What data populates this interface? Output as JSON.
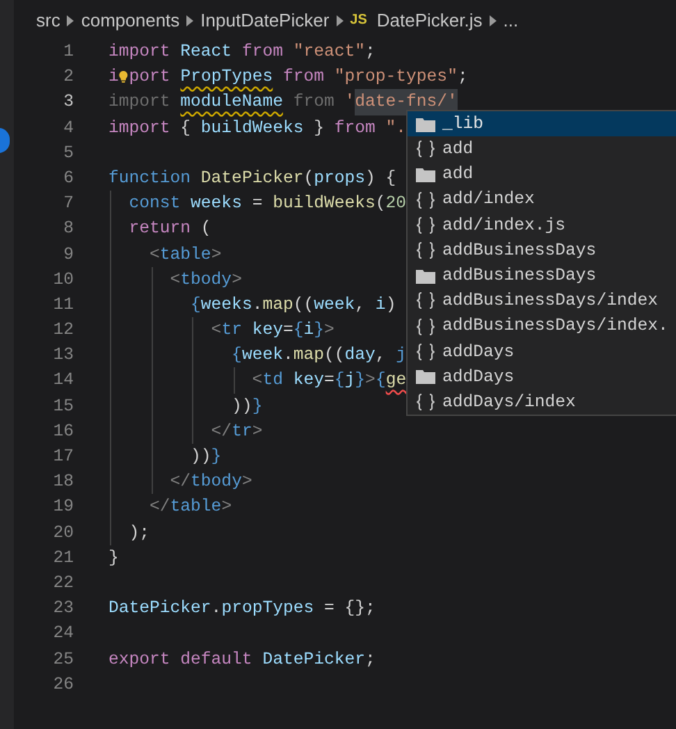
{
  "breadcrumb": [
    {
      "label": "src"
    },
    {
      "label": "components"
    },
    {
      "label": "InputDatePicker"
    },
    {
      "label": "DatePicker.js",
      "badge": "JS"
    },
    {
      "label": "..."
    }
  ],
  "lines": [
    {
      "number": "1",
      "current": false,
      "tokens": [
        {
          "text": "import ",
          "kind": "keyword"
        },
        {
          "text": "React ",
          "kind": "variable"
        },
        {
          "text": "from ",
          "kind": "keyword"
        },
        {
          "text": "\"react\"",
          "kind": "string"
        },
        {
          "text": ";",
          "kind": "punct"
        }
      ]
    },
    {
      "number": "2",
      "current": false,
      "tokens": [
        {
          "text": "i",
          "kind": "keyword"
        },
        {
          "kind": "bulb"
        },
        {
          "text": "port ",
          "kind": "keyword"
        },
        {
          "text": "PropTypes",
          "kind": "variable",
          "warning": true
        },
        {
          "text": " from ",
          "kind": "keyword"
        },
        {
          "text": "\"prop-types\"",
          "kind": "string"
        },
        {
          "text": ";",
          "kind": "punct"
        }
      ]
    },
    {
      "number": "3",
      "current": true,
      "tokens": [
        {
          "text": "import ",
          "kind": "faded"
        },
        {
          "text": "moduleName",
          "kind": "variable",
          "warning": true
        },
        {
          "text": " from ",
          "kind": "faded"
        },
        {
          "text": "'",
          "kind": "string"
        },
        {
          "text": "date-fns/'",
          "kind": "string",
          "highlighted": true
        }
      ]
    },
    {
      "number": "4",
      "current": false,
      "tokens": [
        {
          "text": "import ",
          "kind": "keyword"
        },
        {
          "text": "{ ",
          "kind": "punct"
        },
        {
          "text": "buildWeeks",
          "kind": "variable"
        },
        {
          "text": " } ",
          "kind": "punct"
        },
        {
          "text": "from ",
          "kind": "keyword"
        },
        {
          "text": "\".",
          "kind": "string"
        }
      ]
    },
    {
      "number": "5",
      "current": false
    },
    {
      "number": "6",
      "current": false,
      "tokens": [
        {
          "text": "function ",
          "kind": "tag"
        },
        {
          "text": "DatePicker",
          "kind": "function"
        },
        {
          "text": "(",
          "kind": "punct"
        },
        {
          "text": "props",
          "kind": "variable"
        },
        {
          "text": ") {",
          "kind": "punct"
        }
      ]
    },
    {
      "number": "7",
      "current": false,
      "tokens": [
        {
          "text": "  const ",
          "kind": "tag"
        },
        {
          "text": "weeks",
          "kind": "variable"
        },
        {
          "text": " = ",
          "kind": "punct"
        },
        {
          "text": "buildWeeks",
          "kind": "function"
        },
        {
          "text": "(",
          "kind": "punct"
        },
        {
          "text": "20",
          "kind": "number"
        }
      ]
    },
    {
      "number": "8",
      "current": false,
      "tokens": [
        {
          "text": "  return ",
          "kind": "keyword"
        },
        {
          "text": "(",
          "kind": "punct"
        }
      ]
    },
    {
      "number": "9",
      "current": false,
      "tokens": [
        {
          "text": "    <",
          "kind": "bracket"
        },
        {
          "text": "table",
          "kind": "tag"
        },
        {
          "text": ">",
          "kind": "bracket"
        }
      ]
    },
    {
      "number": "10",
      "current": false,
      "tokens": [
        {
          "text": "      <",
          "kind": "bracket"
        },
        {
          "text": "tbody",
          "kind": "tag"
        },
        {
          "text": ">",
          "kind": "bracket"
        }
      ]
    },
    {
      "number": "11",
      "current": false,
      "tokens": [
        {
          "text": "        {",
          "kind": "tag"
        },
        {
          "text": "weeks",
          "kind": "variable"
        },
        {
          "text": ".",
          "kind": "punct"
        },
        {
          "text": "map",
          "kind": "function"
        },
        {
          "text": "((",
          "kind": "punct"
        },
        {
          "text": "week",
          "kind": "variable"
        },
        {
          "text": ", ",
          "kind": "punct"
        },
        {
          "text": "i",
          "kind": "variable"
        },
        {
          "text": ")",
          "kind": "punct"
        }
      ]
    },
    {
      "number": "12",
      "current": false,
      "tokens": [
        {
          "text": "          <",
          "kind": "bracket"
        },
        {
          "text": "tr ",
          "kind": "tag"
        },
        {
          "text": "key",
          "kind": "variable"
        },
        {
          "text": "=",
          "kind": "punct"
        },
        {
          "text": "{",
          "kind": "tag"
        },
        {
          "text": "i",
          "kind": "variable"
        },
        {
          "text": "}",
          "kind": "tag"
        },
        {
          "text": ">",
          "kind": "bracket"
        }
      ]
    },
    {
      "number": "13",
      "current": false,
      "tokens": [
        {
          "text": "            {",
          "kind": "tag"
        },
        {
          "text": "week",
          "kind": "variable"
        },
        {
          "text": ".",
          "kind": "punct"
        },
        {
          "text": "map",
          "kind": "function"
        },
        {
          "text": "((",
          "kind": "punct"
        },
        {
          "text": "day",
          "kind": "variable"
        },
        {
          "text": ", ",
          "kind": "punct"
        },
        {
          "text": "j",
          "kind": "tag"
        }
      ]
    },
    {
      "number": "14",
      "current": false,
      "tokens": [
        {
          "text": "              <",
          "kind": "bracket"
        },
        {
          "text": "td ",
          "kind": "tag"
        },
        {
          "text": "key",
          "kind": "variable"
        },
        {
          "text": "=",
          "kind": "punct"
        },
        {
          "text": "{",
          "kind": "tag"
        },
        {
          "text": "j",
          "kind": "variable"
        },
        {
          "text": "}",
          "kind": "tag"
        },
        {
          "text": ">",
          "kind": "bracket"
        },
        {
          "text": "{",
          "kind": "tag"
        },
        {
          "text": "ge",
          "kind": "function",
          "error": true
        }
      ]
    },
    {
      "number": "15",
      "current": false,
      "tokens": [
        {
          "text": "            ))",
          "kind": "punct"
        },
        {
          "text": "}",
          "kind": "tag"
        }
      ]
    },
    {
      "number": "16",
      "current": false,
      "tokens": [
        {
          "text": "          </",
          "kind": "bracket"
        },
        {
          "text": "tr",
          "kind": "tag"
        },
        {
          "text": ">",
          "kind": "bracket"
        }
      ]
    },
    {
      "number": "17",
      "current": false,
      "tokens": [
        {
          "text": "        ))",
          "kind": "punct"
        },
        {
          "text": "}",
          "kind": "tag"
        }
      ]
    },
    {
      "number": "18",
      "current": false,
      "tokens": [
        {
          "text": "      </",
          "kind": "bracket"
        },
        {
          "text": "tbody",
          "kind": "tag"
        },
        {
          "text": ">",
          "kind": "bracket"
        }
      ]
    },
    {
      "number": "19",
      "current": false,
      "tokens": [
        {
          "text": "    </",
          "kind": "bracket"
        },
        {
          "text": "table",
          "kind": "tag"
        },
        {
          "text": ">",
          "kind": "bracket"
        }
      ]
    },
    {
      "number": "20",
      "current": false,
      "tokens": [
        {
          "text": "  );",
          "kind": "punct"
        }
      ]
    },
    {
      "number": "21",
      "current": false,
      "tokens": [
        {
          "text": "}",
          "kind": "punct"
        }
      ]
    },
    {
      "number": "22",
      "current": false
    },
    {
      "number": "23",
      "current": false,
      "tokens": [
        {
          "text": "DatePicker",
          "kind": "variable"
        },
        {
          "text": ".",
          "kind": "punct"
        },
        {
          "text": "propTypes",
          "kind": "variable"
        },
        {
          "text": " = {};",
          "kind": "punct"
        }
      ]
    },
    {
      "number": "24",
      "current": false
    },
    {
      "number": "25",
      "current": false,
      "tokens": [
        {
          "text": "export ",
          "kind": "keyword"
        },
        {
          "text": "default ",
          "kind": "keyword"
        },
        {
          "text": "DatePicker",
          "kind": "variable"
        },
        {
          "text": ";",
          "kind": "punct"
        }
      ]
    },
    {
      "number": "26",
      "current": false
    }
  ],
  "suggestions": [
    {
      "label": "_lib",
      "kind": "folder",
      "selected": true
    },
    {
      "label": "add",
      "kind": "module",
      "selected": false
    },
    {
      "label": "add",
      "kind": "folder",
      "selected": false
    },
    {
      "label": "add/index",
      "kind": "module",
      "selected": false
    },
    {
      "label": "add/index.js",
      "kind": "module",
      "selected": false
    },
    {
      "label": "addBusinessDays",
      "kind": "module",
      "selected": false
    },
    {
      "label": "addBusinessDays",
      "kind": "folder",
      "selected": false
    },
    {
      "label": "addBusinessDays/index",
      "kind": "module",
      "selected": false
    },
    {
      "label": "addBusinessDays/index.",
      "kind": "module",
      "selected": false
    },
    {
      "label": "addDays",
      "kind": "module",
      "selected": false
    },
    {
      "label": "addDays",
      "kind": "folder",
      "selected": false
    },
    {
      "label": "addDays/index",
      "kind": "module",
      "selected": false
    }
  ]
}
